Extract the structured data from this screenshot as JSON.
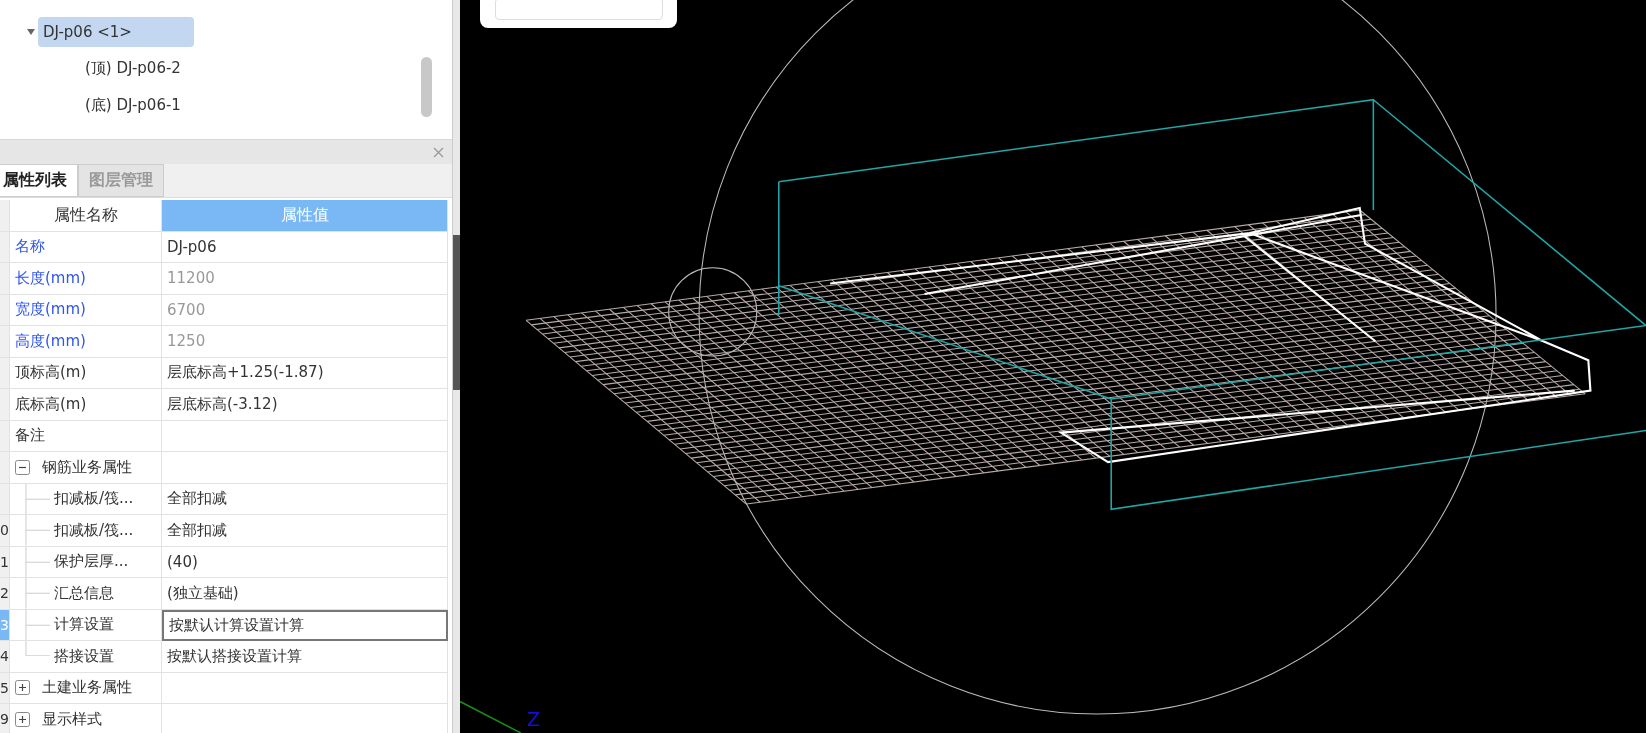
{
  "tree": {
    "items": [
      {
        "label": "DJ-p06 <1>",
        "selected": true,
        "expanded": true,
        "children": [
          {
            "label": "(顶) DJ-p06-2",
            "selected": false
          },
          {
            "label": "(底) DJ-p06-1",
            "selected": false
          }
        ]
      }
    ]
  },
  "tabs": [
    {
      "label": "属性列表",
      "selected": true
    },
    {
      "label": "图层管理",
      "selected": false
    }
  ],
  "table": {
    "columns": [
      {
        "label": "属性名称",
        "selected": false
      },
      {
        "label": "属性值",
        "selected": true
      }
    ],
    "rows": [
      {
        "kind": "prop",
        "name": "名称",
        "value": "DJ-p06",
        "color": "#2f54eb",
        "disabled": false,
        "selected": false
      },
      {
        "kind": "prop",
        "name": "长度(mm)",
        "value": "11200",
        "color": "#2f54eb",
        "disabled": true,
        "selected": false
      },
      {
        "kind": "prop",
        "name": "宽度(mm)",
        "value": "6700",
        "color": "#2f54eb",
        "disabled": true,
        "selected": false
      },
      {
        "kind": "prop",
        "name": "高度(mm)",
        "value": "1250",
        "color": "#2f54eb",
        "disabled": true,
        "selected": false
      },
      {
        "kind": "prop",
        "name": "顶标高(m)",
        "value": "层底标高+1.25(-1.87)",
        "color": "#333333",
        "disabled": false,
        "selected": false
      },
      {
        "kind": "prop",
        "name": "底标高(m)",
        "value": "层底标高(-3.12)",
        "color": "#333333",
        "disabled": false,
        "selected": false
      },
      {
        "kind": "prop",
        "name": "备注",
        "color": "#333333",
        "disabled": false,
        "selected": false
      },
      {
        "kind": "group",
        "name": "钢筋业务属性",
        "expanded": true,
        "selected": false
      },
      {
        "kind": "child",
        "name": "扣减板/筏...",
        "value": "全部扣减",
        "selected": false
      },
      {
        "kind": "child",
        "number": "0",
        "name": "扣减板/筏...",
        "value": "全部扣减",
        "selected": false
      },
      {
        "kind": "child",
        "number": "1",
        "name": "保护层厚...",
        "value": "(40)",
        "selected": false
      },
      {
        "kind": "child",
        "number": "2",
        "name": "汇总信息",
        "value": "(独立基础)",
        "selected": false
      },
      {
        "kind": "child",
        "number": "3",
        "name": "计算设置",
        "value": "按默认计算设置计算",
        "selected": true
      },
      {
        "kind": "child",
        "number": "4",
        "name": "搭接设置",
        "value": "按默认搭接设置计算",
        "selected": false,
        "last": true
      },
      {
        "kind": "group",
        "number": "5",
        "name": "土建业务属性",
        "expanded": false,
        "selected": false
      },
      {
        "kind": "group",
        "number": "9",
        "name": "显示样式",
        "expanded": false,
        "selected": false
      }
    ]
  },
  "viewport": {
    "axis_label": "Z"
  }
}
